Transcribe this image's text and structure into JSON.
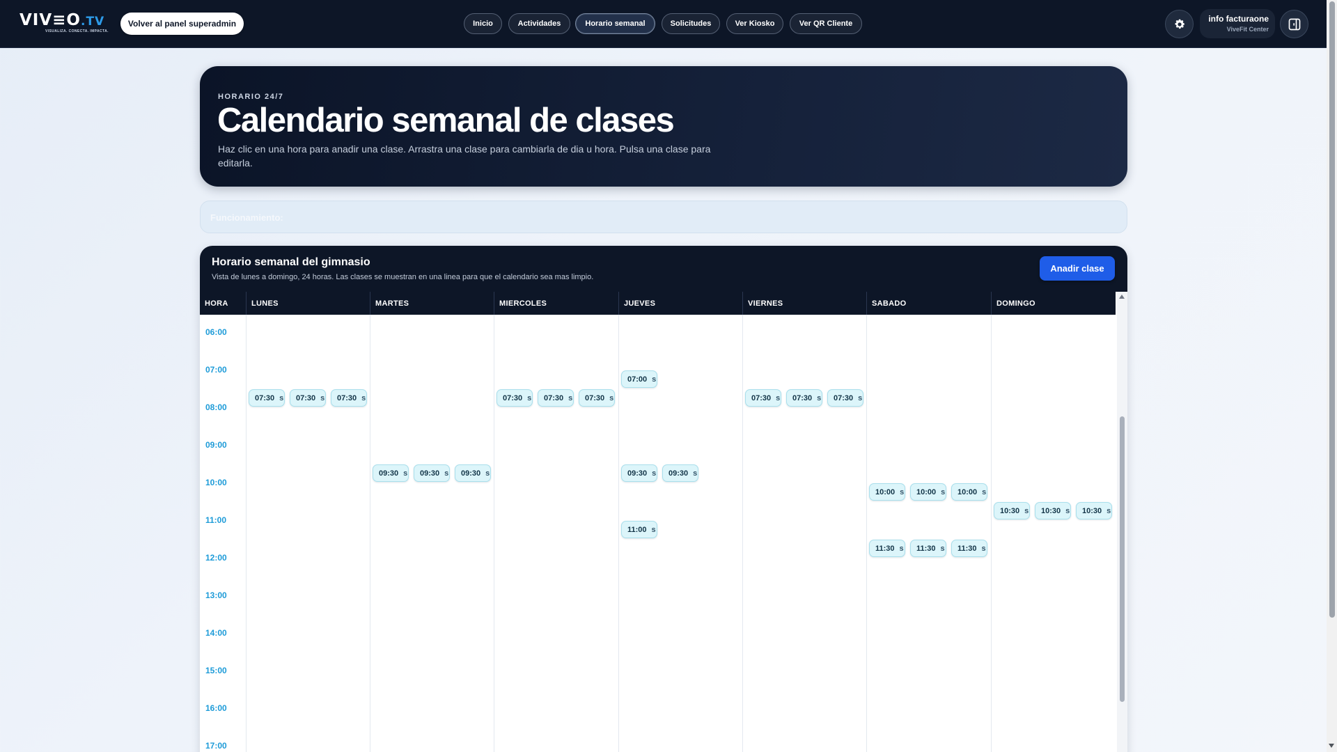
{
  "brand": {
    "name": "VIV≡O",
    "suffix": ".TV",
    "tagline": "VISUALIZA. CONECTA. IMPACTA."
  },
  "topbar": {
    "back_label": "Volver al panel superadmin",
    "nav": [
      {
        "label": "Inicio",
        "active": false
      },
      {
        "label": "Actividades",
        "active": false
      },
      {
        "label": "Horario semanal",
        "active": true
      },
      {
        "label": "Solicitudes",
        "active": false
      },
      {
        "label": "Ver Kiosko",
        "active": false
      },
      {
        "label": "Ver QR Cliente",
        "active": false
      }
    ],
    "settings_icon": "gear-icon",
    "user": {
      "name": "info facturaone",
      "org": "ViveFit Center"
    },
    "panel_icon": "sidebar-panel-icon"
  },
  "hero": {
    "kicker": "HORARIO 24/7",
    "title": "Calendario semanal de clases",
    "description": "Haz clic en una hora para anadir una clase. Arrastra una clase para cambiarla de dia u hora. Pulsa una clase para editarla."
  },
  "info": {
    "label": "Funcionamiento:"
  },
  "schedule": {
    "title": "Horario semanal del gimnasio",
    "subtitle": "Vista de lunes a domingo, 24 horas. Las clases se muestran en una linea para que el calendario sea mas limpio.",
    "add_label": "Anadir clase",
    "columns": [
      "HORA",
      "LUNES",
      "MARTES",
      "MIERCOLES",
      "JUEVES",
      "VIERNES",
      "SABADO",
      "DOMINGO"
    ],
    "hours": [
      "06:00",
      "07:00",
      "08:00",
      "09:00",
      "10:00",
      "11:00",
      "12:00",
      "13:00",
      "14:00",
      "15:00",
      "16:00",
      "17:00"
    ],
    "classes": [
      {
        "day": 0,
        "time": "07:30",
        "slot": 0
      },
      {
        "day": 0,
        "time": "07:30",
        "slot": 1
      },
      {
        "day": 0,
        "time": "07:30",
        "slot": 2
      },
      {
        "day": 1,
        "time": "09:30",
        "slot": 0
      },
      {
        "day": 1,
        "time": "09:30",
        "slot": 1
      },
      {
        "day": 1,
        "time": "09:30",
        "slot": 2
      },
      {
        "day": 2,
        "time": "07:30",
        "slot": 0
      },
      {
        "day": 2,
        "time": "07:30",
        "slot": 1
      },
      {
        "day": 2,
        "time": "07:30",
        "slot": 2
      },
      {
        "day": 3,
        "time": "07:00",
        "slot": 0
      },
      {
        "day": 3,
        "time": "09:30",
        "slot": 0
      },
      {
        "day": 3,
        "time": "09:30",
        "slot": 1
      },
      {
        "day": 3,
        "time": "11:00",
        "slot": 0
      },
      {
        "day": 4,
        "time": "07:30",
        "slot": 0
      },
      {
        "day": 4,
        "time": "07:30",
        "slot": 1
      },
      {
        "day": 4,
        "time": "07:30",
        "slot": 2
      },
      {
        "day": 5,
        "time": "10:00",
        "slot": 0
      },
      {
        "day": 5,
        "time": "10:00",
        "slot": 1
      },
      {
        "day": 5,
        "time": "10:00",
        "slot": 2
      },
      {
        "day": 5,
        "time": "11:30",
        "slot": 0
      },
      {
        "day": 5,
        "time": "11:30",
        "slot": 1
      },
      {
        "day": 5,
        "time": "11:30",
        "slot": 2
      },
      {
        "day": 6,
        "time": "10:30",
        "slot": 0
      },
      {
        "day": 6,
        "time": "10:30",
        "slot": 1
      },
      {
        "day": 6,
        "time": "10:30",
        "slot": 2
      }
    ],
    "truncation": "s"
  },
  "colors": {
    "accent": "#1f5de8",
    "hour_text": "#1d9bd8",
    "chip_bg": "#dcf5fa",
    "dark": "#0d1627"
  }
}
